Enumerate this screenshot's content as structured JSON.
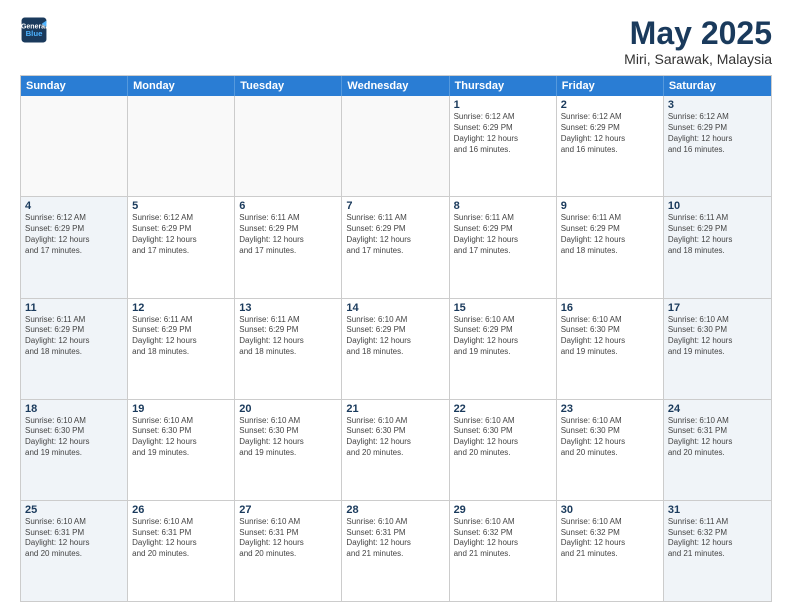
{
  "logo": {
    "line1": "General",
    "line2": "Blue"
  },
  "title": "May 2025",
  "subtitle": "Miri, Sarawak, Malaysia",
  "header_days": [
    "Sunday",
    "Monday",
    "Tuesday",
    "Wednesday",
    "Thursday",
    "Friday",
    "Saturday"
  ],
  "weeks": [
    [
      {
        "day": "",
        "info": ""
      },
      {
        "day": "",
        "info": ""
      },
      {
        "day": "",
        "info": ""
      },
      {
        "day": "",
        "info": ""
      },
      {
        "day": "1",
        "info": "Sunrise: 6:12 AM\nSunset: 6:29 PM\nDaylight: 12 hours\nand 16 minutes."
      },
      {
        "day": "2",
        "info": "Sunrise: 6:12 AM\nSunset: 6:29 PM\nDaylight: 12 hours\nand 16 minutes."
      },
      {
        "day": "3",
        "info": "Sunrise: 6:12 AM\nSunset: 6:29 PM\nDaylight: 12 hours\nand 16 minutes."
      }
    ],
    [
      {
        "day": "4",
        "info": "Sunrise: 6:12 AM\nSunset: 6:29 PM\nDaylight: 12 hours\nand 17 minutes."
      },
      {
        "day": "5",
        "info": "Sunrise: 6:12 AM\nSunset: 6:29 PM\nDaylight: 12 hours\nand 17 minutes."
      },
      {
        "day": "6",
        "info": "Sunrise: 6:11 AM\nSunset: 6:29 PM\nDaylight: 12 hours\nand 17 minutes."
      },
      {
        "day": "7",
        "info": "Sunrise: 6:11 AM\nSunset: 6:29 PM\nDaylight: 12 hours\nand 17 minutes."
      },
      {
        "day": "8",
        "info": "Sunrise: 6:11 AM\nSunset: 6:29 PM\nDaylight: 12 hours\nand 17 minutes."
      },
      {
        "day": "9",
        "info": "Sunrise: 6:11 AM\nSunset: 6:29 PM\nDaylight: 12 hours\nand 18 minutes."
      },
      {
        "day": "10",
        "info": "Sunrise: 6:11 AM\nSunset: 6:29 PM\nDaylight: 12 hours\nand 18 minutes."
      }
    ],
    [
      {
        "day": "11",
        "info": "Sunrise: 6:11 AM\nSunset: 6:29 PM\nDaylight: 12 hours\nand 18 minutes."
      },
      {
        "day": "12",
        "info": "Sunrise: 6:11 AM\nSunset: 6:29 PM\nDaylight: 12 hours\nand 18 minutes."
      },
      {
        "day": "13",
        "info": "Sunrise: 6:11 AM\nSunset: 6:29 PM\nDaylight: 12 hours\nand 18 minutes."
      },
      {
        "day": "14",
        "info": "Sunrise: 6:10 AM\nSunset: 6:29 PM\nDaylight: 12 hours\nand 18 minutes."
      },
      {
        "day": "15",
        "info": "Sunrise: 6:10 AM\nSunset: 6:29 PM\nDaylight: 12 hours\nand 19 minutes."
      },
      {
        "day": "16",
        "info": "Sunrise: 6:10 AM\nSunset: 6:30 PM\nDaylight: 12 hours\nand 19 minutes."
      },
      {
        "day": "17",
        "info": "Sunrise: 6:10 AM\nSunset: 6:30 PM\nDaylight: 12 hours\nand 19 minutes."
      }
    ],
    [
      {
        "day": "18",
        "info": "Sunrise: 6:10 AM\nSunset: 6:30 PM\nDaylight: 12 hours\nand 19 minutes."
      },
      {
        "day": "19",
        "info": "Sunrise: 6:10 AM\nSunset: 6:30 PM\nDaylight: 12 hours\nand 19 minutes."
      },
      {
        "day": "20",
        "info": "Sunrise: 6:10 AM\nSunset: 6:30 PM\nDaylight: 12 hours\nand 19 minutes."
      },
      {
        "day": "21",
        "info": "Sunrise: 6:10 AM\nSunset: 6:30 PM\nDaylight: 12 hours\nand 20 minutes."
      },
      {
        "day": "22",
        "info": "Sunrise: 6:10 AM\nSunset: 6:30 PM\nDaylight: 12 hours\nand 20 minutes."
      },
      {
        "day": "23",
        "info": "Sunrise: 6:10 AM\nSunset: 6:30 PM\nDaylight: 12 hours\nand 20 minutes."
      },
      {
        "day": "24",
        "info": "Sunrise: 6:10 AM\nSunset: 6:31 PM\nDaylight: 12 hours\nand 20 minutes."
      }
    ],
    [
      {
        "day": "25",
        "info": "Sunrise: 6:10 AM\nSunset: 6:31 PM\nDaylight: 12 hours\nand 20 minutes."
      },
      {
        "day": "26",
        "info": "Sunrise: 6:10 AM\nSunset: 6:31 PM\nDaylight: 12 hours\nand 20 minutes."
      },
      {
        "day": "27",
        "info": "Sunrise: 6:10 AM\nSunset: 6:31 PM\nDaylight: 12 hours\nand 20 minutes."
      },
      {
        "day": "28",
        "info": "Sunrise: 6:10 AM\nSunset: 6:31 PM\nDaylight: 12 hours\nand 21 minutes."
      },
      {
        "day": "29",
        "info": "Sunrise: 6:10 AM\nSunset: 6:32 PM\nDaylight: 12 hours\nand 21 minutes."
      },
      {
        "day": "30",
        "info": "Sunrise: 6:10 AM\nSunset: 6:32 PM\nDaylight: 12 hours\nand 21 minutes."
      },
      {
        "day": "31",
        "info": "Sunrise: 6:11 AM\nSunset: 6:32 PM\nDaylight: 12 hours\nand 21 minutes."
      }
    ]
  ]
}
